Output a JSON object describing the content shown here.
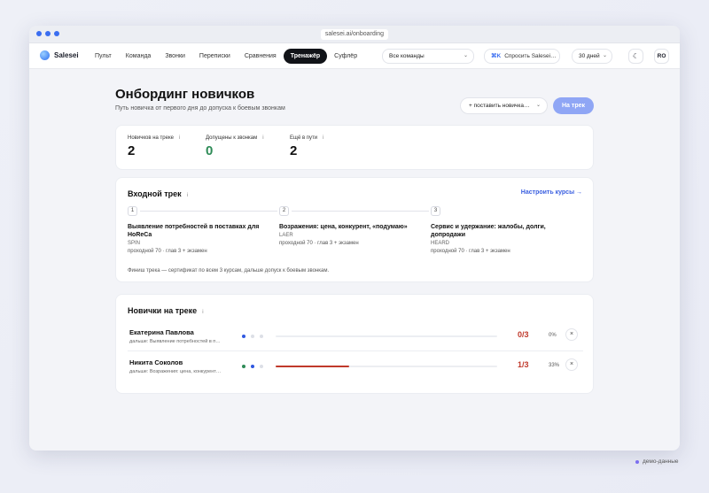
{
  "browser": {
    "url": "salesei.ai/onboarding"
  },
  "brand": {
    "name": "Salesei"
  },
  "nav": {
    "items": [
      {
        "label": "Пульт",
        "active": false
      },
      {
        "label": "Команда",
        "active": false
      },
      {
        "label": "Звонки",
        "active": false
      },
      {
        "label": "Переписки",
        "active": false
      },
      {
        "label": "Сравнения",
        "active": false
      },
      {
        "label": "Тренажёр",
        "active": true
      },
      {
        "label": "Суфлёр",
        "active": false
      }
    ],
    "team_select": "Все команды",
    "ask_shortcut": "⌘K",
    "ask_label": "Спросить Salesei…",
    "period_select": "30 дней",
    "theme_icon": "moon-icon",
    "user_initials": "RO"
  },
  "page": {
    "title": "Онбординг новичков",
    "subtitle": "Путь новичка от первого дня до допуска к боевым звонкам",
    "add_button": "+ поставить новичка…",
    "track_button": "На трек"
  },
  "stats": [
    {
      "label": "Новичков на треке",
      "value": "2",
      "color": "#111111"
    },
    {
      "label": "Допущены к звонкам",
      "value": "0",
      "color": "#2e8b57"
    },
    {
      "label": "Ещё в пути",
      "value": "2",
      "color": "#111111"
    }
  ],
  "track": {
    "title": "Входной трек",
    "configure_link": "Настроить курсы →",
    "courses": [
      {
        "num": "1",
        "name": "Выявление потребностей в поставках для HoReCa",
        "method": "SPIN",
        "meta": "проходной 70 · глав 3 + экзамен"
      },
      {
        "num": "2",
        "name": "Возражения: цена, конкурент, «подумаю»",
        "method": "LAER",
        "meta": "проходной 70 · глав 3 + экзамен"
      },
      {
        "num": "3",
        "name": "Сервис и удержание: жалобы, долги, допродажи",
        "method": "HEARD",
        "meta": "проходной 70 · глав 3 + экзамен"
      }
    ],
    "footer": "Финиш трека — сертификат по всем 3 курсам, дальше допуск к боевым звонкам."
  },
  "newbies": {
    "title": "Новички на треке",
    "rows": [
      {
        "name": "Екатерина Павлова",
        "next": "дальше: Выявление потребностей в п…",
        "dots": [
          "blue",
          "gray",
          "gray"
        ],
        "progress": 0,
        "score": "0/3",
        "pct": "0%"
      },
      {
        "name": "Никита Соколов",
        "next": "дальше: Возражения: цена, конкурент…",
        "dots": [
          "green",
          "blue",
          "gray"
        ],
        "progress": 0.33,
        "score": "1/3",
        "pct": "33%"
      }
    ]
  },
  "demo_badge": "демо-данные",
  "colors": {
    "accent": "#3a6df0",
    "danger": "#c0392b",
    "success": "#2e8b57",
    "track_button": "#8fa6f5"
  }
}
